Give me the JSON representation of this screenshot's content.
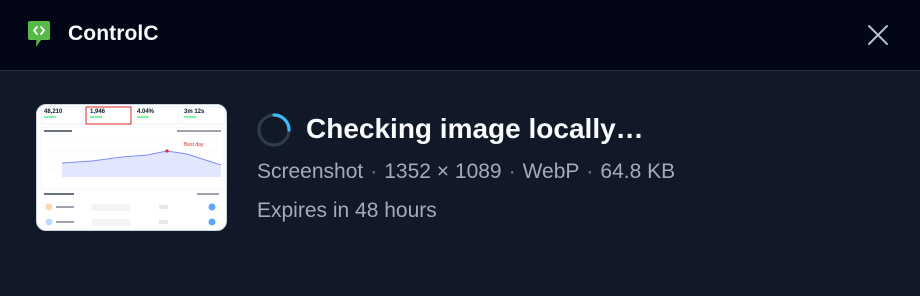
{
  "header": {
    "app_title": "ControlC",
    "logo_icon": "controlc-logo-icon",
    "close_icon": "close-icon",
    "logo_color": "#58b947"
  },
  "upload": {
    "status": "Checking image locally…",
    "meta": {
      "type": "Screenshot",
      "dimensions": "1352 × 1089",
      "format": "WebP",
      "size": "64.8 KB",
      "separator": "·"
    },
    "expires": "Expires in 48 hours",
    "spinner_color": "#38bdf8"
  },
  "thumbnail": {
    "stats": [
      "48,210",
      "1,946",
      "4.04%",
      "3m 12s"
    ],
    "annotation": "Best day"
  }
}
